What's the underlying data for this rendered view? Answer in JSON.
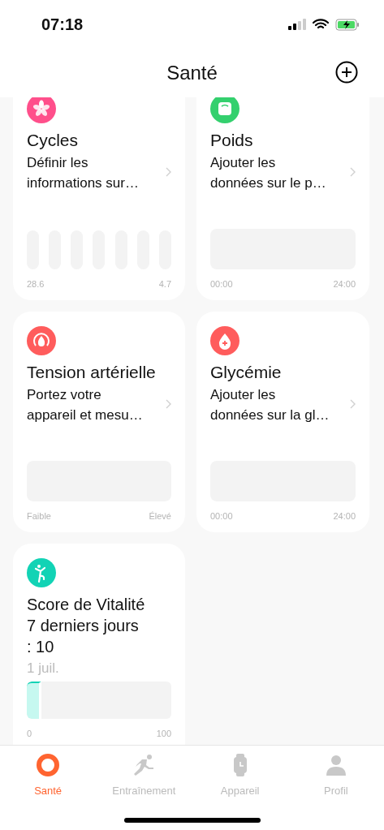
{
  "status_bar": {
    "time": "07:18"
  },
  "header": {
    "title": "Santé"
  },
  "cards": [
    {
      "kind": "bars",
      "color": "#ff4f8b",
      "title": "Cycles",
      "subtitle": "Définir les informations sur…",
      "axis": [
        "28.6",
        "4.7"
      ]
    },
    {
      "kind": "area",
      "color": "#34d06e",
      "title": "Poids",
      "subtitle": "Ajouter les données sur le p…",
      "axis": [
        "00:00",
        "24:00"
      ]
    },
    {
      "kind": "area",
      "color": "#ff5c5c",
      "title": "Tension artérielle",
      "subtitle": "Portez votre appareil et mesu…",
      "axis": [
        "Faible",
        "Élevé"
      ]
    },
    {
      "kind": "area",
      "color": "#ff5c5c",
      "title": "Glycémie",
      "subtitle": "Ajouter les données sur la gl…",
      "axis": [
        "00:00",
        "24:00"
      ]
    },
    {
      "kind": "score",
      "color": "#12d3b5",
      "title": "Score de Vitalité 7 derniers jours : 10",
      "date": "1 juil.",
      "level": 0.1,
      "axis": [
        "0",
        "100"
      ]
    }
  ],
  "tab_bar": [
    {
      "label": "Santé",
      "selected": true
    },
    {
      "label": "Entraînement",
      "selected": false
    },
    {
      "label": "Appareil",
      "selected": false
    },
    {
      "label": "Profil",
      "selected": false
    }
  ]
}
